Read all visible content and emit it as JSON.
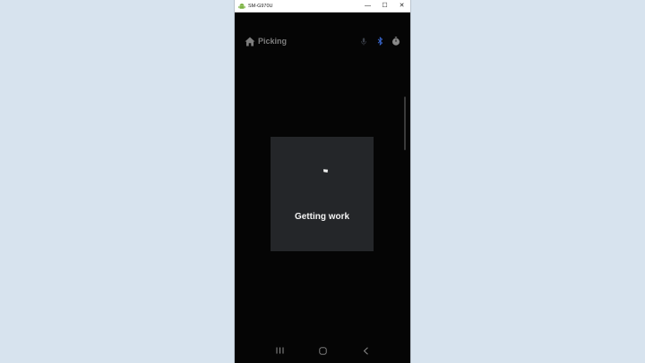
{
  "window": {
    "title": "SM-G970U",
    "controls": {
      "minimize": "—",
      "maximize": "☐",
      "close": "✕"
    }
  },
  "appbar": {
    "title": "Picking",
    "icons": [
      "home-icon",
      "microphone-icon",
      "bluetooth-icon",
      "timer-icon"
    ]
  },
  "dialog": {
    "message": "Getting work"
  },
  "navbar": {
    "icons": [
      "recent-apps-icon",
      "home-nav-icon",
      "back-icon"
    ]
  },
  "colors": {
    "desktop_bg": "#d7e3ee",
    "screen_bg": "#050505",
    "dialog_bg": "#242629",
    "bluetooth": "#3b6bd6",
    "muted": "#7d7d7d"
  }
}
